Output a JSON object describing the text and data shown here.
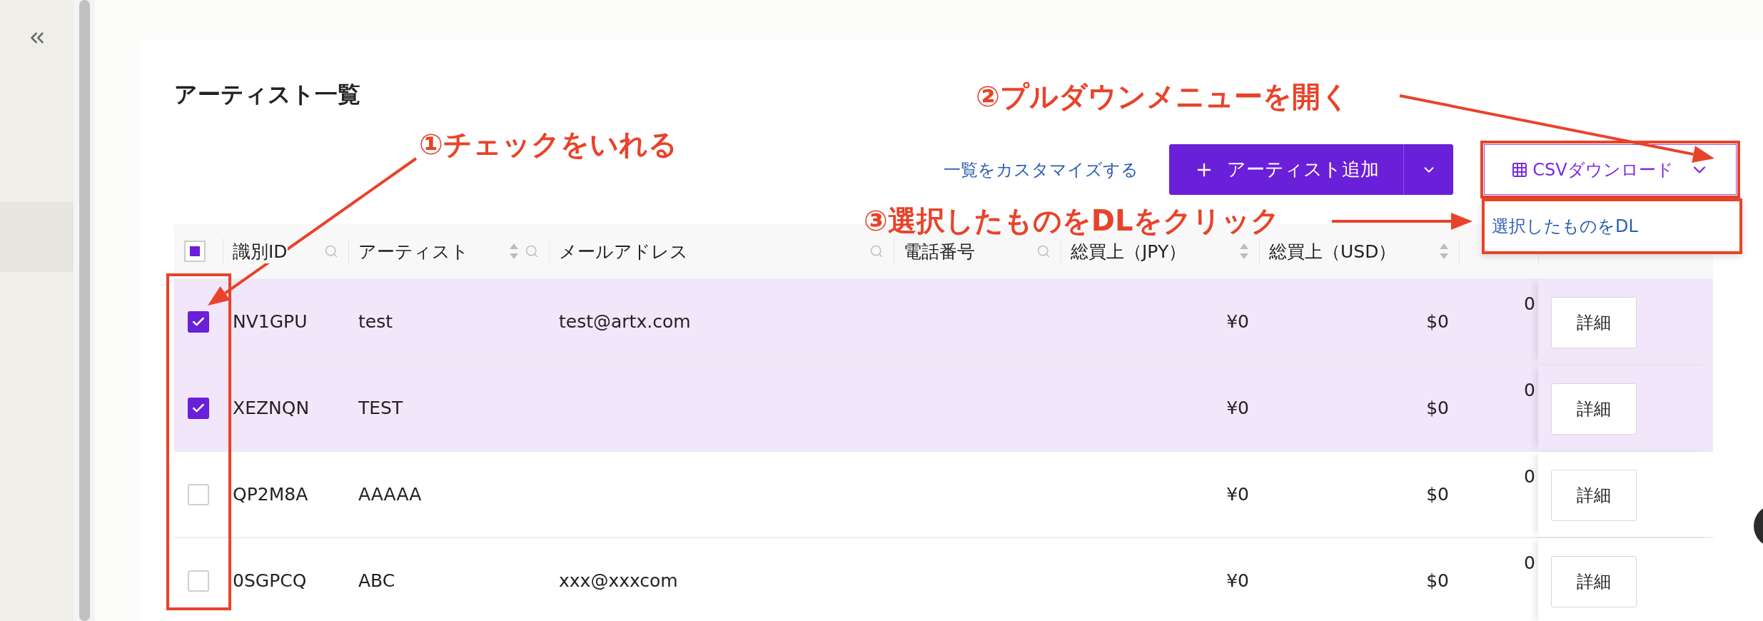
{
  "page": {
    "title": "アーティスト一覧"
  },
  "toolbar": {
    "customize_link": "一覧をカスタマイズする",
    "add_button": "アーティスト追加",
    "csv_button": "CSVダウンロード"
  },
  "dropdown": {
    "items": [
      "選択したものをDL"
    ]
  },
  "table": {
    "header_checkbox": {
      "indeterminate": true
    },
    "columns": [
      {
        "label": "識別ID",
        "sortable": false,
        "searchable": true
      },
      {
        "label": "アーティスト",
        "sortable": true,
        "searchable": true
      },
      {
        "label": "メールアドレス",
        "sortable": false,
        "searchable": true
      },
      {
        "label": "電話番号",
        "sortable": false,
        "searchable": true
      },
      {
        "label": "総買上（JPY）",
        "sortable": true,
        "searchable": false
      },
      {
        "label": "総買上（USD）",
        "sortable": true,
        "searchable": false
      }
    ],
    "rows": [
      {
        "checked": true,
        "id": "NV1GPU",
        "artist": "test",
        "email": "test@artx.com",
        "sales_jpy": "¥0",
        "sales_usd": "$0",
        "column_8": "0",
        "action": "詳細"
      },
      {
        "checked": true,
        "id": "XEZNQN",
        "artist": "TEST",
        "sales_jpy": "¥0",
        "sales_usd": "$0",
        "column_8": "0",
        "action": "詳細"
      },
      {
        "checked": false,
        "id": "QP2M8A",
        "artist": "AAAAA",
        "sales_jpy": "¥0",
        "sales_usd": "$0",
        "column_8": "0",
        "action": "詳細"
      },
      {
        "checked": false,
        "id": "0SGPCQ",
        "artist": "ABC",
        "email": "xxx@xxxcom",
        "sales_jpy": "¥0",
        "sales_usd": "$0",
        "column_8": "0",
        "action": "詳細"
      }
    ]
  },
  "annotations": [
    {
      "text": "②プルダウンメニューを開く"
    },
    {
      "text": "①チェックをいれる"
    },
    {
      "text": "③選択したものをDLをクリック"
    }
  ]
}
